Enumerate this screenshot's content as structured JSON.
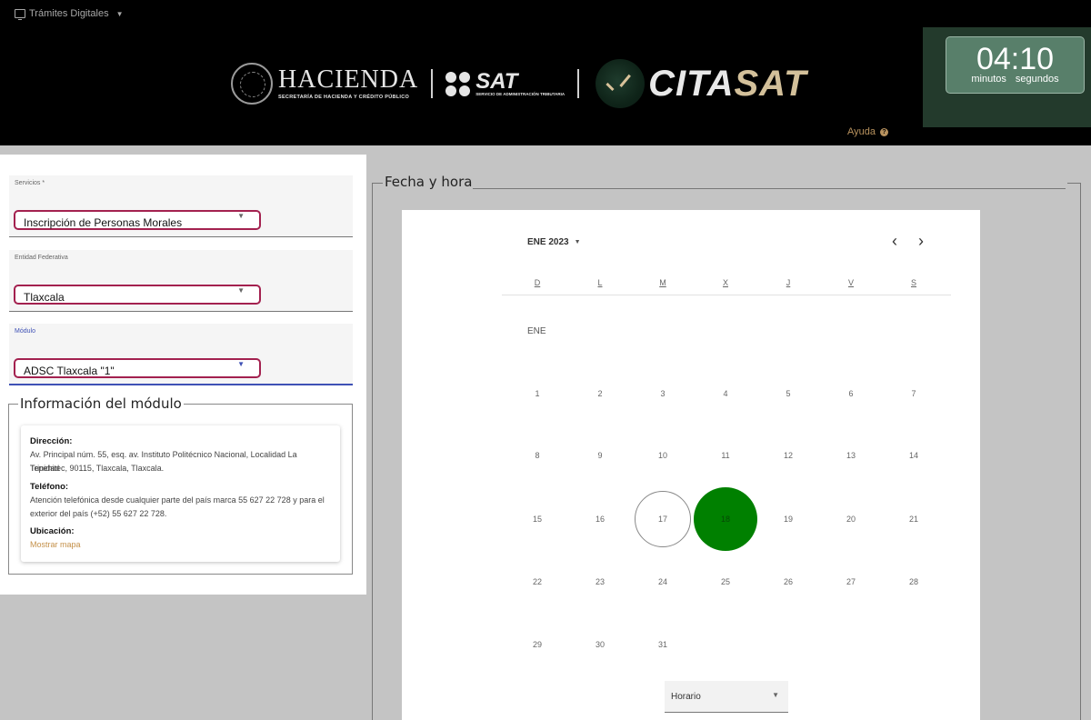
{
  "header": {
    "tramites_label": "Trámites Digitales",
    "hacienda_title": "HACIENDA",
    "hacienda_subtitle": "SECRETARÍA DE HACIENDA Y CRÉDITO PÚBLICO",
    "sat_title": "SAT",
    "sat_subtitle": "SERVICIO DE ADMINISTRACIÓN TRIBUTARIA",
    "citasat_cita": "CITA",
    "citasat_sat": "SAT",
    "ayuda_label": "Ayuda"
  },
  "timer": {
    "time": "04:10",
    "minutes_label": "minutos",
    "seconds_label": "segundos"
  },
  "form": {
    "servicios_label": "Servicios *",
    "servicios_value": "Inscripción de Personas Morales",
    "entidad_label": "Entidad Federativa",
    "entidad_value": "Tlaxcala",
    "modulo_label": "Módulo",
    "modulo_value": "ADSC Tlaxcala \"1\""
  },
  "info": {
    "title": "Información del módulo",
    "direccion_label": "Dirección:",
    "direccion_line1": "Av. Principal núm. 55, esq. av. Instituto Politécnico Nacional, Localidad La Trinidad",
    "direccion_line2": "Tepehitec, 90115, Tlaxcala, Tlaxcala.",
    "telefono_label": "Teléfono:",
    "telefono_line1": "Atención telefónica desde cualquier parte del país marca 55 627 22 728 y para el",
    "telefono_line2": "exterior del país (+52) 55 627 22 728.",
    "ubicacion_label": "Ubicación:",
    "mapa_link": "Mostrar mapa"
  },
  "fecha_hora": {
    "title": "Fecha y hora",
    "calendar_header": "ENE 2023",
    "month_label": "ENE",
    "weekdays": [
      "D",
      "L",
      "M",
      "X",
      "J",
      "V",
      "S"
    ],
    "weeks": [
      [
        "1",
        "2",
        "3",
        "4",
        "5",
        "6",
        "7"
      ],
      [
        "8",
        "9",
        "10",
        "11",
        "12",
        "13",
        "14"
      ],
      [
        "15",
        "16",
        "17",
        "18",
        "19",
        "20",
        "21"
      ],
      [
        "22",
        "23",
        "24",
        "25",
        "26",
        "27",
        "28"
      ],
      [
        "29",
        "30",
        "31"
      ]
    ],
    "today": "17",
    "selected": "18",
    "selected_color": "#008000",
    "horario_label": "Horario"
  }
}
